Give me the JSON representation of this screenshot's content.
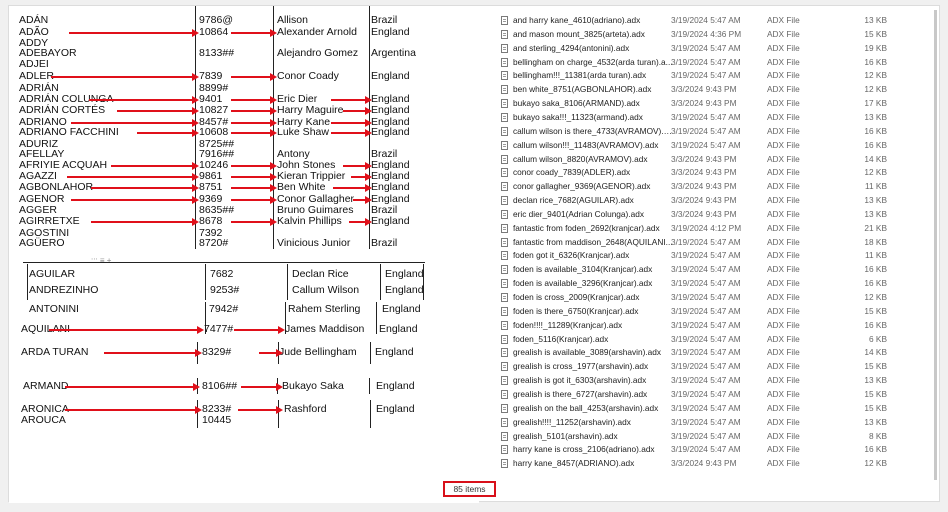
{
  "left": {
    "name_rows": [
      {
        "name": "ADÁN",
        "code": "9786@",
        "player": "Allison",
        "country": "Brazil"
      },
      {
        "name": "ADÃO",
        "code": "10864",
        "player": "Alexander Arnold",
        "country": "England"
      },
      {
        "name": "ADDY",
        "code": "",
        "player": "",
        "country": ""
      },
      {
        "name": "ADEBAYOR",
        "code": "8133##",
        "player": "Alejandro Gomez",
        "country": "Argentina"
      },
      {
        "name": "ADJEI",
        "code": "",
        "player": "",
        "country": ""
      },
      {
        "name": "ADLER",
        "code": "7839",
        "player": "Conor Coady",
        "country": "England"
      },
      {
        "name": "ADRIÁN",
        "code": "8899#",
        "player": "",
        "country": ""
      },
      {
        "name": "ADRIÁN COLUNGA",
        "code": "9401",
        "player": "Eric Dier",
        "country": "England"
      },
      {
        "name": "ADRIÁN CORTÉS",
        "code": "10827",
        "player": "Harry Maguire",
        "country": "England"
      },
      {
        "name": "ADRIANO",
        "code": "8457#",
        "player": "Harry Kane",
        "country": "England"
      },
      {
        "name": "ADRIANO FACCHINI",
        "code": "10608",
        "player": "Luke Shaw",
        "country": "England"
      },
      {
        "name": "ADURIZ",
        "code": "8725##",
        "player": "",
        "country": ""
      },
      {
        "name": "AFELLAY",
        "code": "7916##",
        "player": "Antony",
        "country": "Brazil"
      },
      {
        "name": "AFRIYIE ACQUAH",
        "code": "10246",
        "player": "John Stones",
        "country": "England"
      },
      {
        "name": "AGAZZI",
        "code": "9861",
        "player": "Kieran Trippier",
        "country": "England"
      },
      {
        "name": "AGBONLAHOR",
        "code": "8751",
        "player": "Ben White",
        "country": "England"
      },
      {
        "name": "AGENOR",
        "code": "9369",
        "player": "Conor Gallagher",
        "country": "England"
      },
      {
        "name": "AGGER",
        "code": "8635##",
        "player": "Bruno Guimares",
        "country": "Brazil"
      },
      {
        "name": "AGIRRETXE",
        "code": "8678",
        "player": "Kalvin Phillips",
        "country": "England"
      },
      {
        "name": "AGOSTINI",
        "code": "7392",
        "player": "",
        "country": ""
      },
      {
        "name": "AGÜERO",
        "code": "8720#",
        "player": "Vinicious Junior",
        "country": "Brazil"
      }
    ],
    "lower_rows": [
      {
        "name": "AGUILAR",
        "code": "7682",
        "player": "Declan Rice",
        "country": "England"
      },
      {
        "name": "ANDREZINHO",
        "code": "9253#",
        "player": "Callum Wilson",
        "country": "England"
      },
      {
        "name": "ANTONINI",
        "code": "7942#",
        "player": "Rahem Sterling",
        "country": "England"
      },
      {
        "name": "AQUILANI",
        "code": "7477#",
        "player": "James Maddison",
        "country": "England"
      },
      {
        "name": "ARDA TURAN",
        "code": "8329#",
        "player": "Jude Bellingham",
        "country": "England"
      },
      {
        "name": "ARMAND",
        "code": "8106##",
        "player": "Bukayo Saka",
        "country": "England"
      },
      {
        "name": "ARONICA",
        "code": "8233#",
        "player": "Rashford",
        "country": "England"
      },
      {
        "name": "AROUCA",
        "code": "10445",
        "player": "",
        "country": ""
      }
    ],
    "handle_text": "::: ≡ +"
  },
  "files": [
    {
      "name": "and harry kane_4610(adriano).adx",
      "date": "3/19/2024 5:47 AM",
      "type": "ADX File",
      "size": "13 KB"
    },
    {
      "name": "and mason mount_3825(arteta).adx",
      "date": "3/19/2024 4:36 PM",
      "type": "ADX File",
      "size": "15 KB"
    },
    {
      "name": "and sterling_4294(antonini).adx",
      "date": "3/19/2024 5:47 AM",
      "type": "ADX File",
      "size": "19 KB"
    },
    {
      "name": "bellingham on charge_4532(arda turan).a...",
      "date": "3/19/2024 5:47 AM",
      "type": "ADX File",
      "size": "16 KB"
    },
    {
      "name": "bellingham!!!_11381(arda turan).adx",
      "date": "3/19/2024 5:47 AM",
      "type": "ADX File",
      "size": "12 KB"
    },
    {
      "name": "ben white_8751(AGBONLAHOR).adx",
      "date": "3/3/2024 9:43 PM",
      "type": "ADX File",
      "size": "12 KB"
    },
    {
      "name": "bukayo saka_8106(ARMAND).adx",
      "date": "3/3/2024 9:43 PM",
      "type": "ADX File",
      "size": "17 KB"
    },
    {
      "name": "bukayo saka!!!_11323(armand).adx",
      "date": "3/19/2024 5:47 AM",
      "type": "ADX File",
      "size": "13 KB"
    },
    {
      "name": "callum wilson is there_4733(AVRAMOV).a...",
      "date": "3/19/2024 5:47 AM",
      "type": "ADX File",
      "size": "16 KB"
    },
    {
      "name": "callum wilson!!!_11483(AVRAMOV).adx",
      "date": "3/19/2024 5:47 AM",
      "type": "ADX File",
      "size": "16 KB"
    },
    {
      "name": "callum wilson_8820(AVRAMOV).adx",
      "date": "3/3/2024 9:43 PM",
      "type": "ADX File",
      "size": "14 KB"
    },
    {
      "name": "conor coady_7839(ADLER).adx",
      "date": "3/3/2024 9:43 PM",
      "type": "ADX File",
      "size": "12 KB"
    },
    {
      "name": "conor gallagher_9369(AGENOR).adx",
      "date": "3/3/2024 9:43 PM",
      "type": "ADX File",
      "size": "11 KB"
    },
    {
      "name": "declan rice_7682(AGUILAR).adx",
      "date": "3/3/2024 9:43 PM",
      "type": "ADX File",
      "size": "13 KB"
    },
    {
      "name": "eric dier_9401(Adrian Colunga).adx",
      "date": "3/3/2024 9:43 PM",
      "type": "ADX File",
      "size": "13 KB"
    },
    {
      "name": "fantastic from foden_2692(kranjcar).adx",
      "date": "3/19/2024 4:12 PM",
      "type": "ADX File",
      "size": "21 KB"
    },
    {
      "name": "fantastic from maddison_2648(AQUILANI...",
      "date": "3/19/2024 5:47 AM",
      "type": "ADX File",
      "size": "18 KB"
    },
    {
      "name": "foden got it_6326(Kranjcar).adx",
      "date": "3/19/2024 5:47 AM",
      "type": "ADX File",
      "size": "11 KB"
    },
    {
      "name": "foden is available_3104(Kranjcar).adx",
      "date": "3/19/2024 5:47 AM",
      "type": "ADX File",
      "size": "16 KB"
    },
    {
      "name": "foden is available_3296(Kranjcar).adx",
      "date": "3/19/2024 5:47 AM",
      "type": "ADX File",
      "size": "16 KB"
    },
    {
      "name": "foden is cross_2009(Kranjcar).adx",
      "date": "3/19/2024 5:47 AM",
      "type": "ADX File",
      "size": "12 KB"
    },
    {
      "name": "foden is there_6750(Kranjcar).adx",
      "date": "3/19/2024 5:47 AM",
      "type": "ADX File",
      "size": "15 KB"
    },
    {
      "name": "foden!!!!_11289(Kranjcar).adx",
      "date": "3/19/2024 5:47 AM",
      "type": "ADX File",
      "size": "16 KB"
    },
    {
      "name": "foden_5116(Kranjcar).adx",
      "date": "3/19/2024 5:47 AM",
      "type": "ADX File",
      "size": "6 KB"
    },
    {
      "name": "grealish is available_3089(arshavin).adx",
      "date": "3/19/2024 5:47 AM",
      "type": "ADX File",
      "size": "14 KB"
    },
    {
      "name": "grealish is cross_1977(arshavin).adx",
      "date": "3/19/2024 5:47 AM",
      "type": "ADX File",
      "size": "15 KB"
    },
    {
      "name": "grealish is got it_6303(arshavin).adx",
      "date": "3/19/2024 5:47 AM",
      "type": "ADX File",
      "size": "13 KB"
    },
    {
      "name": "grealish is there_6727(arshavin).adx",
      "date": "3/19/2024 5:47 AM",
      "type": "ADX File",
      "size": "15 KB"
    },
    {
      "name": "grealish on the ball_4253(arshavin).adx",
      "date": "3/19/2024 5:47 AM",
      "type": "ADX File",
      "size": "15 KB"
    },
    {
      "name": "grealish!!!!_11252(arshavin).adx",
      "date": "3/19/2024 5:47 AM",
      "type": "ADX File",
      "size": "13 KB"
    },
    {
      "name": "grealish_5101(arshavin).adx",
      "date": "3/19/2024 5:47 AM",
      "type": "ADX File",
      "size": "8 KB"
    },
    {
      "name": "harry kane is cross_2106(adriano).adx",
      "date": "3/19/2024 5:47 AM",
      "type": "ADX File",
      "size": "16 KB"
    },
    {
      "name": "harry kane_8457(ADRIANO).adx",
      "date": "3/3/2024 9:43 PM",
      "type": "ADX File",
      "size": "12 KB"
    }
  ],
  "status": {
    "item_count": "85 items"
  },
  "colors": {
    "arrow": "#e0101a",
    "highlight_border": "#d8101a"
  }
}
